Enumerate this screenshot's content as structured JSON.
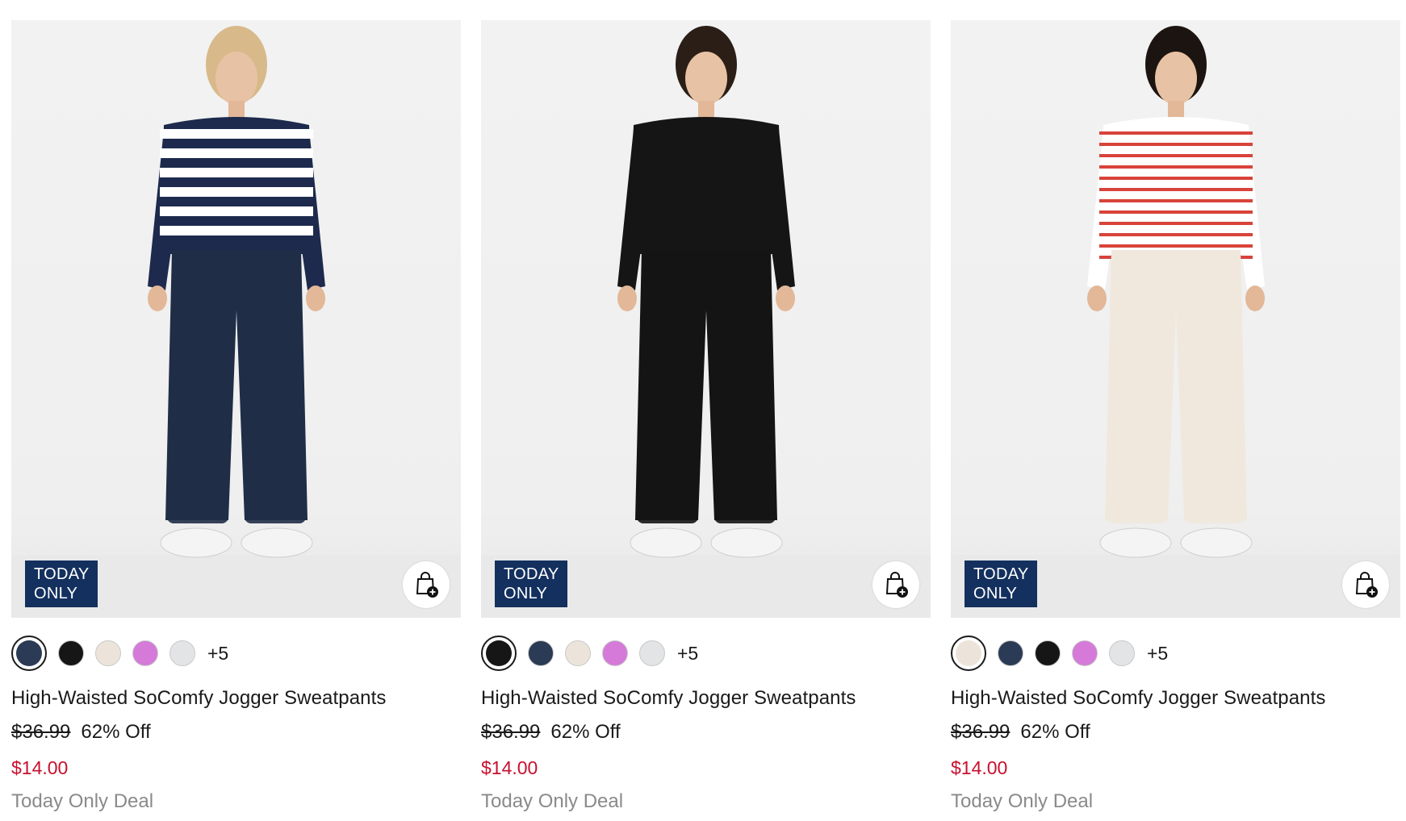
{
  "products": [
    {
      "badge": [
        "TODAY",
        "ONLY"
      ],
      "title": "High-Waisted SoComfy Jogger Sweatpants",
      "original_price": "$36.99",
      "discount": "62% Off",
      "sale_price": "$14.00",
      "deal_text": "Today Only Deal",
      "more_colors": "+5",
      "swatches": [
        "#2b3a55",
        "#161616",
        "#ece4da",
        "#d57ad9",
        "#e2e4e6"
      ],
      "selected_swatch": 0,
      "top_color": "#1d2a4d",
      "top_stripe": "#ffffff",
      "pants_color": "#1f2d47",
      "hair_color": "#d8b98a",
      "stripe_style": "wide"
    },
    {
      "badge": [
        "TODAY",
        "ONLY"
      ],
      "title": "High-Waisted SoComfy Jogger Sweatpants",
      "original_price": "$36.99",
      "discount": "62% Off",
      "sale_price": "$14.00",
      "deal_text": "Today Only Deal",
      "more_colors": "+5",
      "swatches": [
        "#161616",
        "#2b3a55",
        "#ece4da",
        "#d57ad9",
        "#e2e4e6"
      ],
      "selected_swatch": 0,
      "top_color": "#151515",
      "top_stripe": "#151515",
      "pants_color": "#141414",
      "hair_color": "#2a1e17",
      "stripe_style": "none"
    },
    {
      "badge": [
        "TODAY",
        "ONLY"
      ],
      "title": "High-Waisted SoComfy Jogger Sweatpants",
      "original_price": "$36.99",
      "discount": "62% Off",
      "sale_price": "$14.00",
      "deal_text": "Today Only Deal",
      "more_colors": "+5",
      "swatches": [
        "#ece4da",
        "#2b3a55",
        "#161616",
        "#d57ad9",
        "#e2e4e6"
      ],
      "selected_swatch": 0,
      "top_color": "#ffffff",
      "top_stripe": "#d8433a",
      "pants_color": "#f0e8dc",
      "hair_color": "#1c1410",
      "stripe_style": "thin"
    }
  ]
}
